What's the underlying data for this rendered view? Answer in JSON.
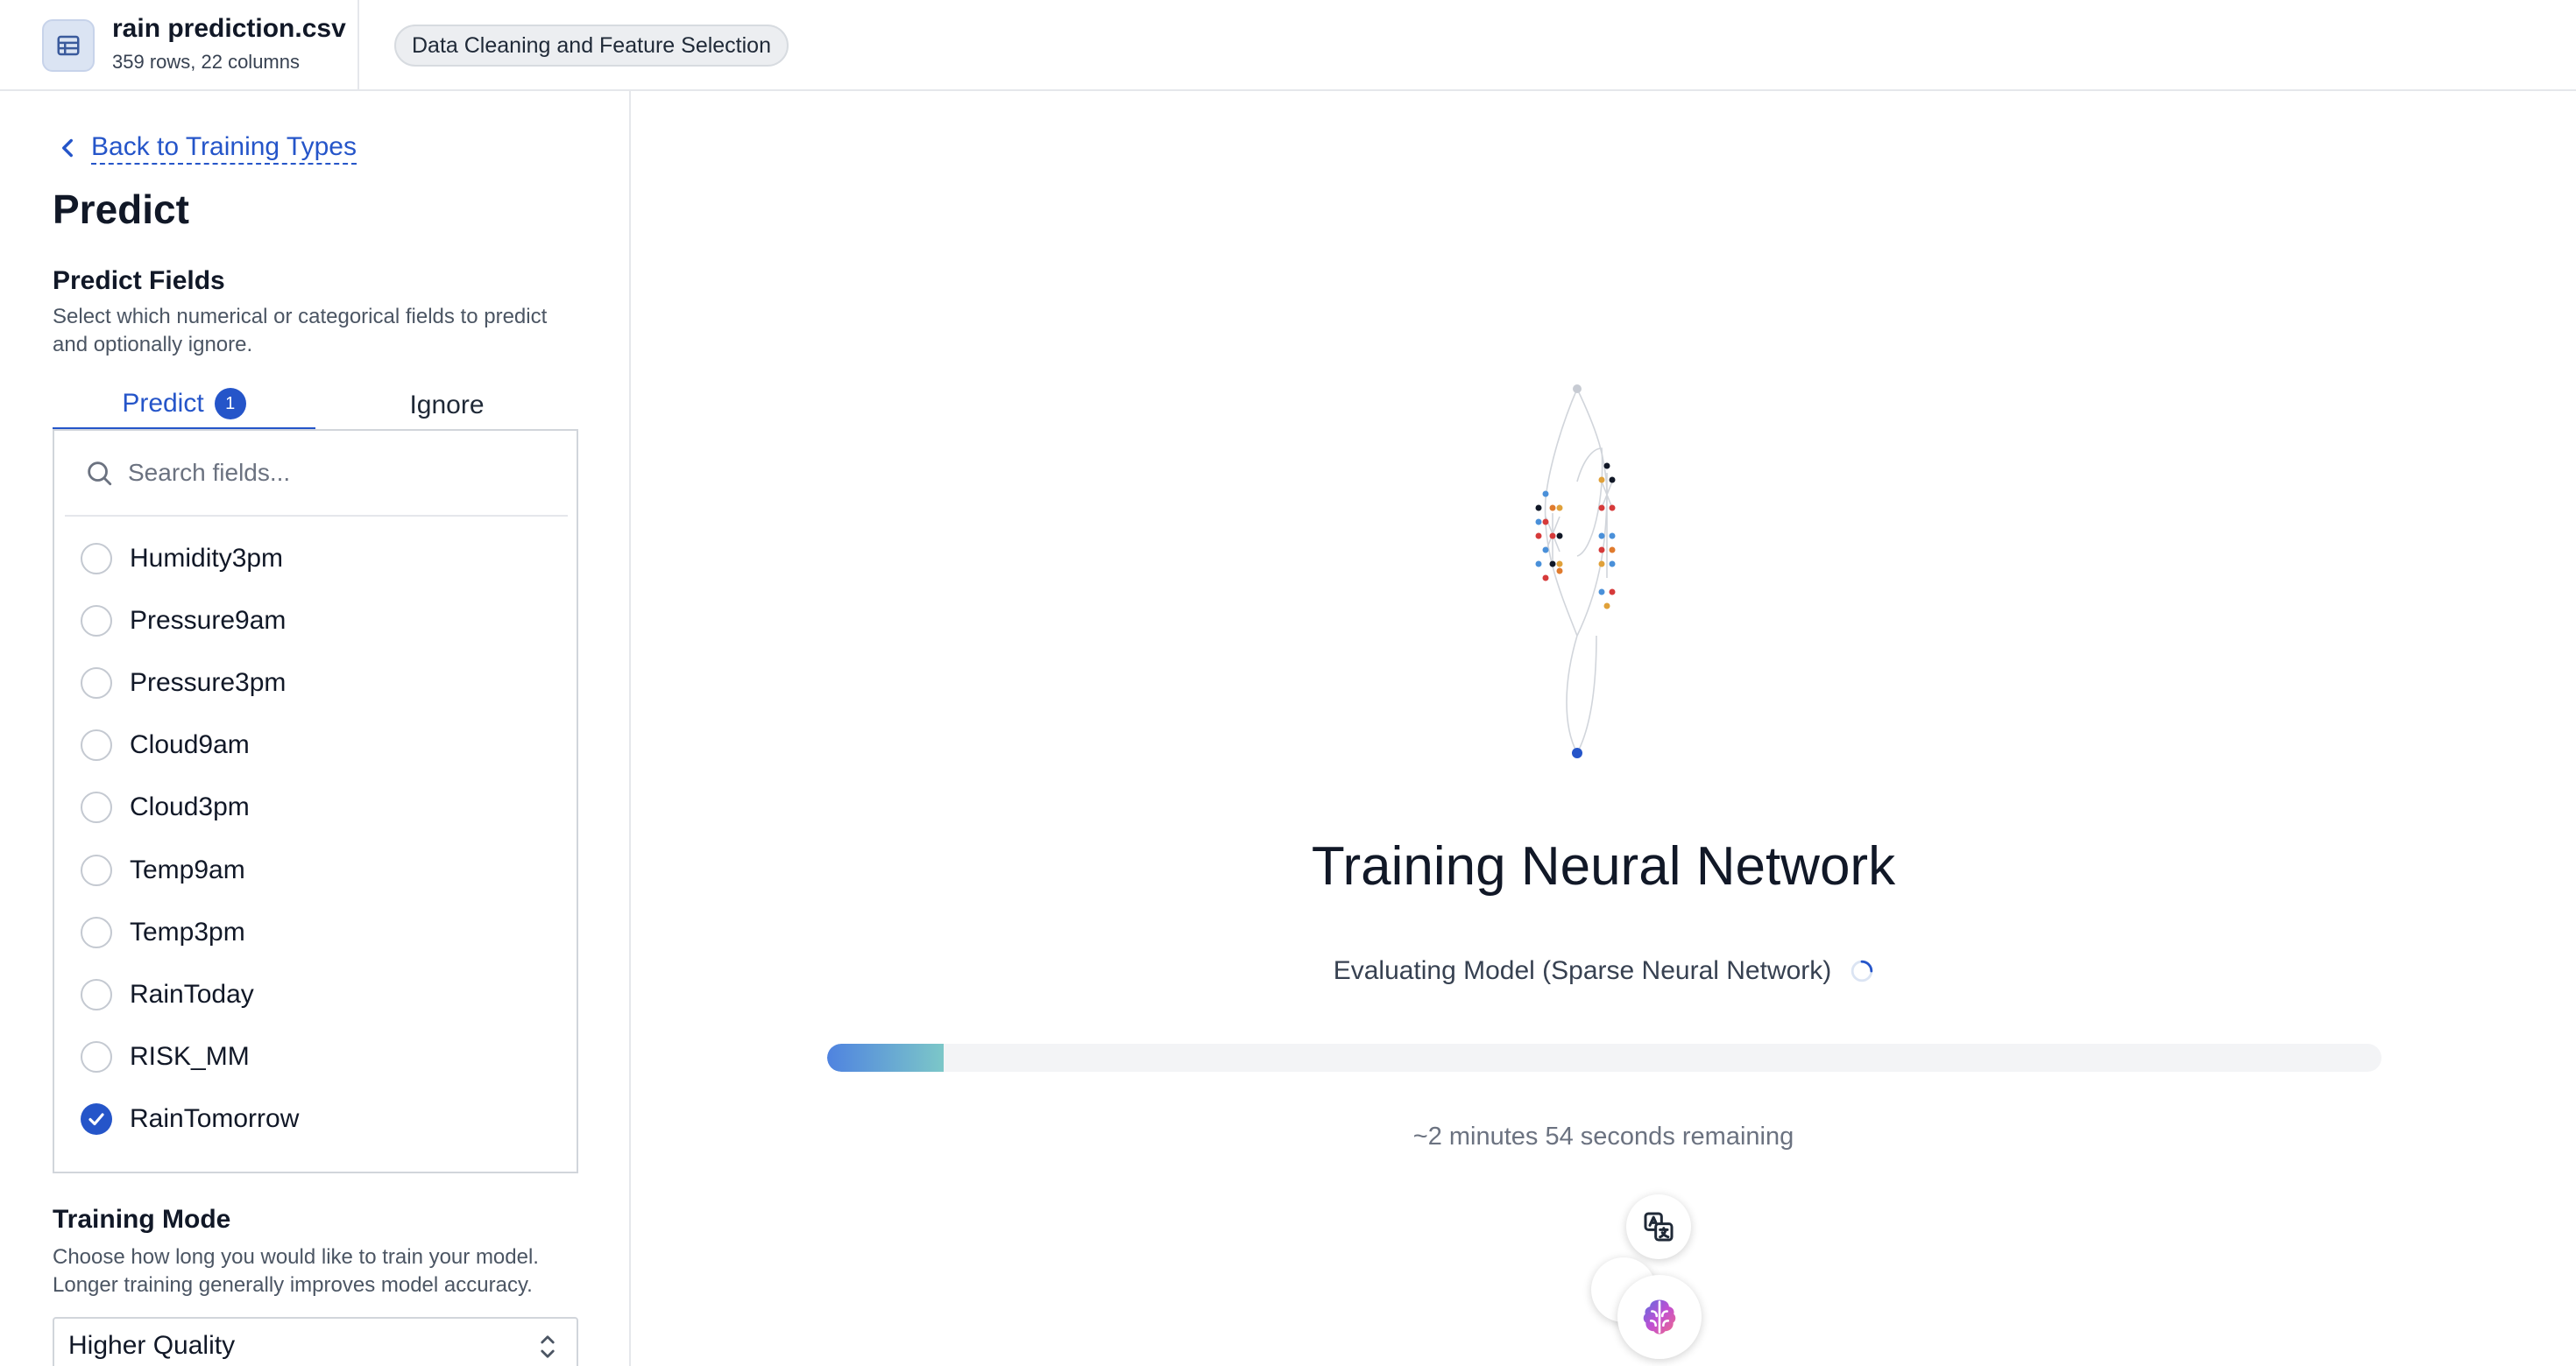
{
  "header": {
    "file_name": "rain prediction.csv",
    "file_meta": "359 rows, 22 columns",
    "step_label": "Data Cleaning and Feature Selection"
  },
  "sidebar": {
    "back_label": "Back to Training Types",
    "title": "Predict",
    "predict_fields": {
      "title": "Predict Fields",
      "description": "Select which numerical or categorical fields to predict and optionally ignore."
    },
    "tabs": {
      "predict_label": "Predict",
      "predict_count": "1",
      "ignore_label": "Ignore"
    },
    "search_placeholder": "Search fields...",
    "fields": [
      {
        "label": "Humidity3pm",
        "checked": false
      },
      {
        "label": "Pressure9am",
        "checked": false
      },
      {
        "label": "Pressure3pm",
        "checked": false
      },
      {
        "label": "Cloud9am",
        "checked": false
      },
      {
        "label": "Cloud3pm",
        "checked": false
      },
      {
        "label": "Temp9am",
        "checked": false
      },
      {
        "label": "Temp3pm",
        "checked": false
      },
      {
        "label": "RainToday",
        "checked": false
      },
      {
        "label": "RISK_MM",
        "checked": false
      },
      {
        "label": "RainTomorrow",
        "checked": true
      }
    ],
    "training_mode": {
      "title": "Training Mode",
      "description": "Choose how long you would like to train your model. Longer training generally improves model accuracy.",
      "selected": "Higher Quality"
    }
  },
  "main": {
    "title": "Training Neural Network",
    "status": "Evaluating Model (Sparse Neural Network)",
    "progress": 0.075,
    "remaining": "~2 minutes 54 seconds remaining"
  },
  "colors": {
    "accent": "#2555c9",
    "progress_start": "#4f83e0",
    "progress_end": "#7cc7c8"
  },
  "icons": {
    "file": "table-icon",
    "back": "chevron-left-icon",
    "search": "search-icon",
    "select": "chevron-up-down-icon",
    "status": "spinner-icon",
    "translate": "translate-icon",
    "assistant": "brain-icon"
  }
}
